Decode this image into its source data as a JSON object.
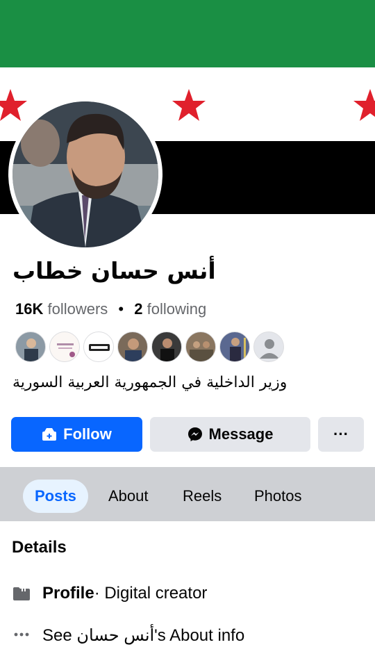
{
  "profile": {
    "name": "أنس حسان خطاب",
    "followers_count": "16K",
    "followers_label": "followers",
    "following_count": "2",
    "following_label": "following",
    "bio": "وزير الداخلية في الجمهورية العربية السورية"
  },
  "colors": {
    "flag_green": "#1a8f44",
    "flag_red_star": "#e0202c",
    "accent": "#0866ff"
  },
  "actions": {
    "follow": "Follow",
    "message": "Message",
    "more": "···"
  },
  "tabs": [
    {
      "label": "Posts",
      "active": true
    },
    {
      "label": "About"
    },
    {
      "label": "Reels"
    },
    {
      "label": "Photos"
    }
  ],
  "details": {
    "title": "Details",
    "profile_label": "Profile",
    "profile_value": " · Digital creator",
    "about_text": "See أنس حسان's About info"
  },
  "icons": [
    "follow-icon",
    "messenger-icon",
    "more-icon",
    "profile-card-icon",
    "dots-icon"
  ]
}
